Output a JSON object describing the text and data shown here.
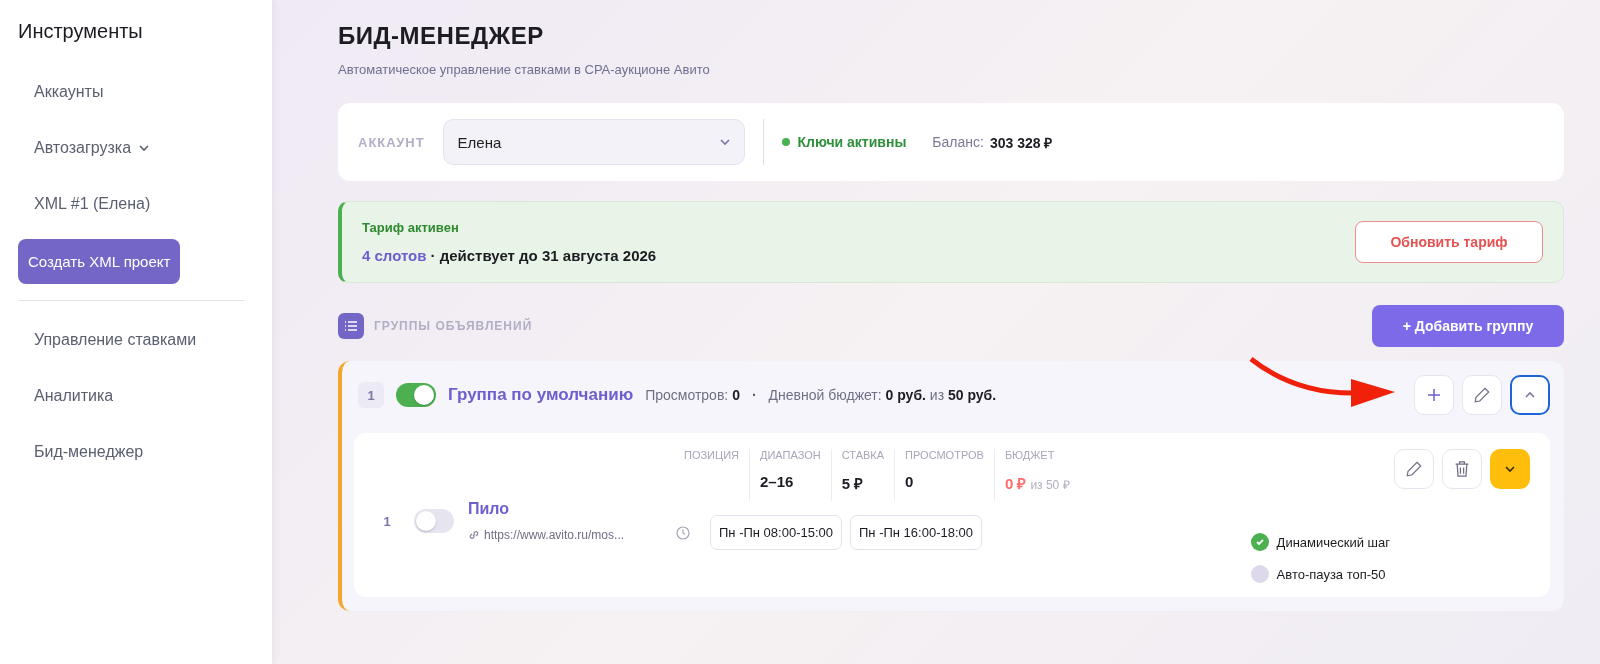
{
  "sidebar": {
    "title": "Инструменты",
    "top_items": [
      {
        "kind": "link",
        "label": "Аккаунты"
      },
      {
        "kind": "dropdown",
        "label": "Автозагрузка",
        "expanded": true
      },
      {
        "kind": "link",
        "label": "XML #1 (Елена)"
      },
      {
        "kind": "button",
        "label": "Создать XML проект"
      }
    ],
    "bottom_items": [
      {
        "kind": "link",
        "label": "Управление ставками"
      },
      {
        "kind": "link",
        "label": "Аналитика"
      },
      {
        "kind": "link",
        "label": "Бид-менеджер"
      }
    ]
  },
  "header": {
    "title": "БИД-МЕНЕДЖЕР",
    "subtitle": "Автоматическое управление ставками в CPA-аукционе Авито"
  },
  "account": {
    "label": "АККАУНТ",
    "value": "Елена",
    "keys_status": {
      "text": "Ключи активны",
      "on": true
    },
    "balance_label": "Баланс:",
    "balance_value": "303 328 ₽"
  },
  "tariff": {
    "title": "Тариф активен",
    "slots": "4 слотов",
    "validity": "· действует до 31 августа 2026",
    "button": "Обновить тариф"
  },
  "groups_section": {
    "title": "ГРУППЫ ОБЪЯВЛЕНИЙ",
    "add_button": "+ Добавить группу",
    "groups": [
      {
        "index": "1",
        "enabled": true,
        "name": "Группа по умолчанию",
        "views_label": "Просмотров:",
        "views": "0",
        "separator": "·",
        "budget_label": "Дневной бюджет:",
        "budget_spent": "0 руб.",
        "budget_of": "из",
        "budget_total": "50 руб.",
        "expanded": true,
        "items": [
          {
            "index": "1",
            "enabled": false,
            "name": "Пило",
            "url": "https://www.avito.ru/mos...",
            "expanded": false,
            "metrics": [
              {
                "kind": "plain",
                "label": "ПОЗИЦИЯ"
              },
              {
                "kind": "plain",
                "label": "ДИАПАЗОН",
                "value": "2–16"
              },
              {
                "kind": "plain",
                "label": "СТАВКА",
                "value": "5 ₽"
              },
              {
                "kind": "plain",
                "label": "ПРОСМОТРОВ",
                "value": "0"
              },
              {
                "kind": "budget",
                "label": "БЮДЖЕТ",
                "value": "0 ₽",
                "extra": "из 50 ₽"
              }
            ],
            "schedules": [
              "Пн -Пн 08:00-15:00",
              "Пн -Пн 16:00-18:00"
            ],
            "options": [
              {
                "label": "Динамический шаг",
                "checked": true
              },
              {
                "label": "Авто-пауза топ-50",
                "checked": false
              }
            ]
          }
        ]
      }
    ]
  }
}
